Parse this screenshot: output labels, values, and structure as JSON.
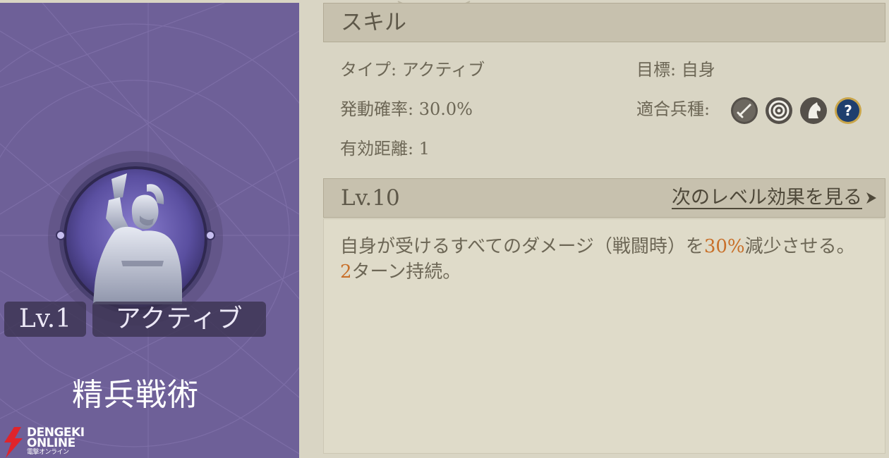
{
  "skill_card": {
    "level": "Lv.1",
    "type": "アクティブ",
    "name": "精兵戦術",
    "colors": {
      "card_bg": "#6e6098",
      "badge_bg": "#3a3250"
    }
  },
  "watermark": {
    "line1": "DENGEKI",
    "line2": "ONLINE",
    "line3": "電撃オンライン"
  },
  "skill_panel": {
    "title": "スキル",
    "type_label": "タイプ:",
    "type_value": "アクティブ",
    "target_label": "目標:",
    "target_value": "自身",
    "rate_label": "発動確率:",
    "rate_value": "30.0%",
    "troops_label": "適合兵種:",
    "troop_icons": [
      "sword-icon",
      "target-icon",
      "horse-icon",
      "question-icon"
    ],
    "range_label": "有効距離:",
    "range_value": "1"
  },
  "level_panel": {
    "level": "Lv.10",
    "next_link": "次のレベル効果を見る",
    "desc": {
      "part1": "自身が受けるすべてのダメージ（戦闘時）を",
      "highlight1": "30%",
      "part2": "減少させる。",
      "highlight2": "2",
      "part3": "ターン持続。"
    },
    "highlight_color": "#c8702a"
  }
}
